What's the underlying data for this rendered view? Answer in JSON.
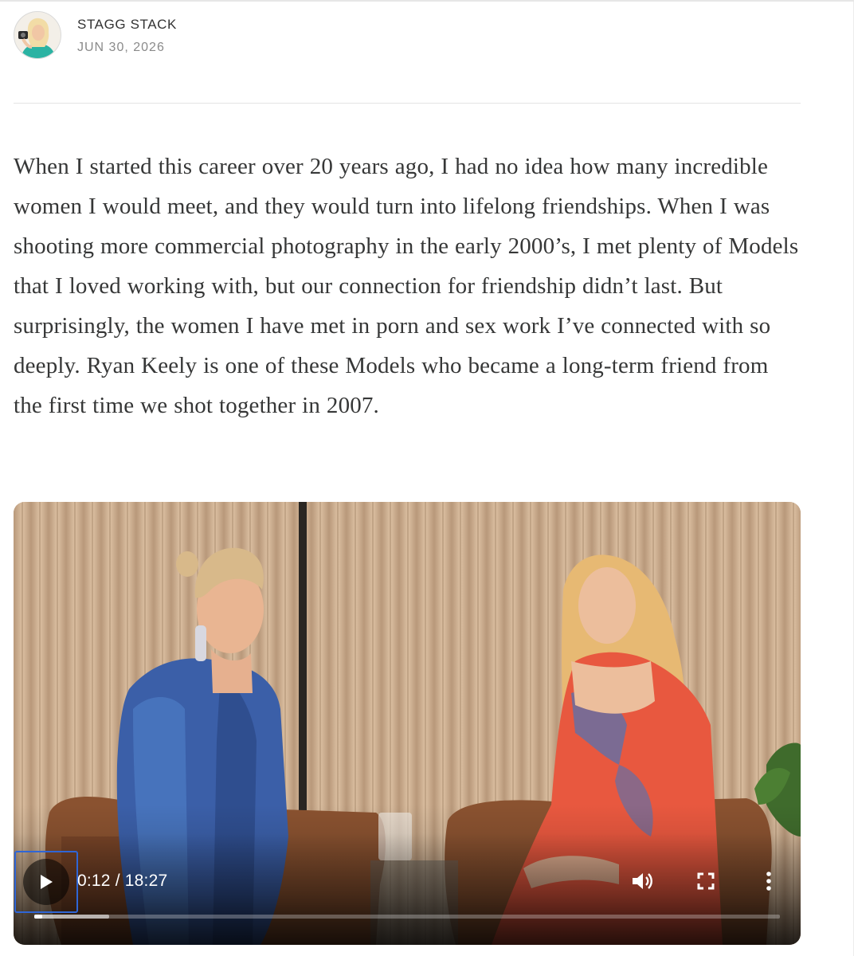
{
  "byline": {
    "author": "STAGG STACK",
    "date": "JUN 30, 2026"
  },
  "article": {
    "paragraph": "When I started this career over 20 years ago, I had no idea how many incredible women I would meet, and they would turn into lifelong friendships. When I was shooting more commercial photography in the early 2000’s, I met plenty of Models that I loved working with, but our connection for friendship didn’t last. But surprisingly, the women I have met in porn and sex work I’ve connected with so deeply. Ryan Keely is one of these Models who became a long-term friend from the first time we shot together in 2007."
  },
  "video": {
    "time": "0:12 / 18:27",
    "progress_played_fraction": 0.0108,
    "progress_buffered_fraction": 0.1,
    "icons": {
      "play": "play-icon",
      "volume": "volume-icon",
      "fullscreen": "fullscreen-icon",
      "more": "more-vertical-icon"
    }
  },
  "colors": {
    "body_text": "#363737",
    "date_text": "#8a8a8a",
    "focus_ring": "#2f66d6"
  }
}
